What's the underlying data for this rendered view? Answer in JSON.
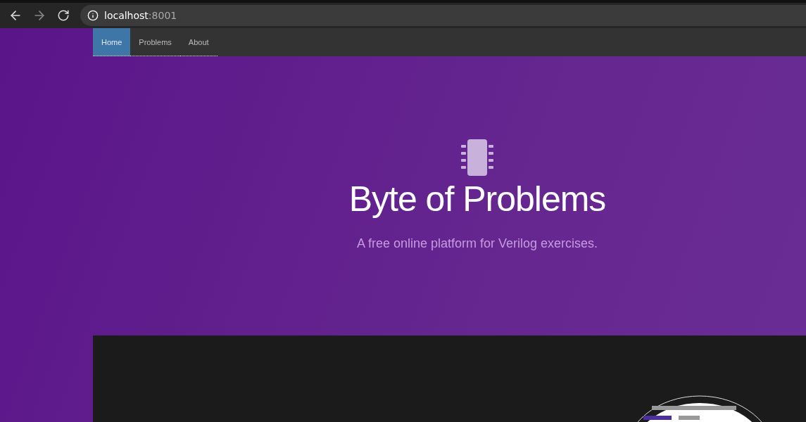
{
  "browser": {
    "address_host": "localhost",
    "address_port": ":8001"
  },
  "nav": {
    "items": [
      {
        "label": "Home",
        "selected": true
      },
      {
        "label": "Problems",
        "selected": false
      },
      {
        "label": "About",
        "selected": false
      }
    ]
  },
  "hero": {
    "title": "Byte of Problems",
    "subtitle": "A free online platform for Verilog exercises."
  }
}
